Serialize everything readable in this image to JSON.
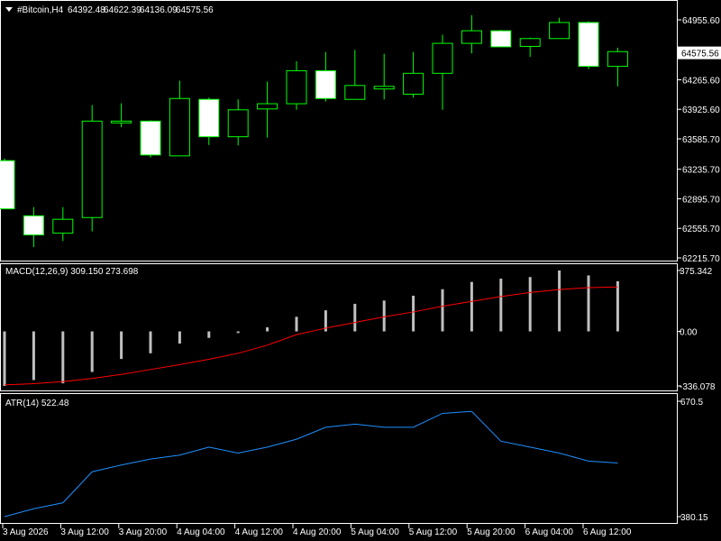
{
  "chart_data": {
    "type": "candlestick",
    "symbol_label": "#Bitcoin,H4",
    "ohlc_readout": [
      "64392.48",
      "64622.39",
      "64136.09",
      "64575.56"
    ],
    "current_price_label": "64575.56",
    "colors": {
      "background": "#000000",
      "grid_border": "#ffffff",
      "bull_fill": "#000000",
      "bear_fill": "#ffffff",
      "candle_outline": "#00ff00",
      "macd_hist": "#c0c0c0",
      "macd_signal": "#ff0000",
      "atr_line": "#1e90ff"
    },
    "price_axis": {
      "ticks": [
        "64955.60",
        "64575.56",
        "64265.60",
        "63925.60",
        "63585.70",
        "63235.70",
        "62895.70",
        "62555.70",
        "62215.70"
      ]
    },
    "candles": [
      {
        "o": 63335,
        "h": 63360,
        "l": 62780,
        "c": 62780
      },
      {
        "o": 62700,
        "h": 62800,
        "l": 62340,
        "c": 62480
      },
      {
        "o": 62500,
        "h": 62800,
        "l": 62410,
        "c": 62660
      },
      {
        "o": 62680,
        "h": 63975,
        "l": 62520,
        "c": 63790
      },
      {
        "o": 63770,
        "h": 63995,
        "l": 63720,
        "c": 63790
      },
      {
        "o": 63790,
        "h": 63800,
        "l": 63370,
        "c": 63400
      },
      {
        "o": 63390,
        "h": 64255,
        "l": 63390,
        "c": 64050
      },
      {
        "o": 64040,
        "h": 64060,
        "l": 63515,
        "c": 63610
      },
      {
        "o": 63610,
        "h": 64040,
        "l": 63510,
        "c": 63920
      },
      {
        "o": 63930,
        "h": 64245,
        "l": 63600,
        "c": 63990
      },
      {
        "o": 63990,
        "h": 64480,
        "l": 63920,
        "c": 64370
      },
      {
        "o": 64370,
        "h": 64585,
        "l": 64015,
        "c": 64050
      },
      {
        "o": 64040,
        "h": 64610,
        "l": 64040,
        "c": 64200
      },
      {
        "o": 64160,
        "h": 64565,
        "l": 64040,
        "c": 64190
      },
      {
        "o": 64100,
        "h": 64585,
        "l": 64060,
        "c": 64340
      },
      {
        "o": 64340,
        "h": 64785,
        "l": 63920,
        "c": 64685
      },
      {
        "o": 64685,
        "h": 65010,
        "l": 64570,
        "c": 64830
      },
      {
        "o": 64830,
        "h": 64840,
        "l": 64640,
        "c": 64645
      },
      {
        "o": 64650,
        "h": 64750,
        "l": 64530,
        "c": 64740
      },
      {
        "o": 64740,
        "h": 64980,
        "l": 64740,
        "c": 64925
      },
      {
        "o": 64925,
        "h": 64940,
        "l": 64390,
        "c": 64420
      },
      {
        "o": 64420,
        "h": 64635,
        "l": 64190,
        "c": 64590
      }
    ],
    "macd": {
      "label": "MACD(12,26,9) 309.150 273.698",
      "axis_ticks": [
        "375.342",
        "0.00",
        "-336.078"
      ],
      "hist": [
        -336.078,
        -300,
        -320,
        -250,
        -170,
        -135,
        -75,
        -40,
        -10,
        25,
        90,
        130,
        170,
        190,
        220,
        260,
        305,
        325,
        335,
        375.342,
        345,
        309.15
      ],
      "signal": [
        -330,
        -322,
        -310,
        -290,
        -265,
        -235,
        -205,
        -172,
        -135,
        -85,
        -20,
        20,
        55,
        90,
        120,
        155,
        185,
        215,
        240,
        258,
        270,
        273.698
      ]
    },
    "atr": {
      "label": "ATR(14) 522.48",
      "axis_ticks": [
        "670.5",
        "380.15"
      ],
      "values": [
        380.15,
        400,
        415,
        493,
        510,
        525,
        535,
        555,
        540,
        555,
        575,
        605,
        613,
        605,
        605,
        640,
        645,
        570,
        555,
        540,
        520,
        515
      ]
    },
    "x_ticks": [
      "3 Aug 2026",
      "3 Aug 12:00",
      "3 Aug 20:00",
      "4 Aug 04:00",
      "4 Aug 12:00",
      "4 Aug 20:00",
      "5 Aug 04:00",
      "5 Aug 12:00",
      "5 Aug 20:00",
      "6 Aug 04:00",
      "6 Aug 12:00"
    ]
  }
}
